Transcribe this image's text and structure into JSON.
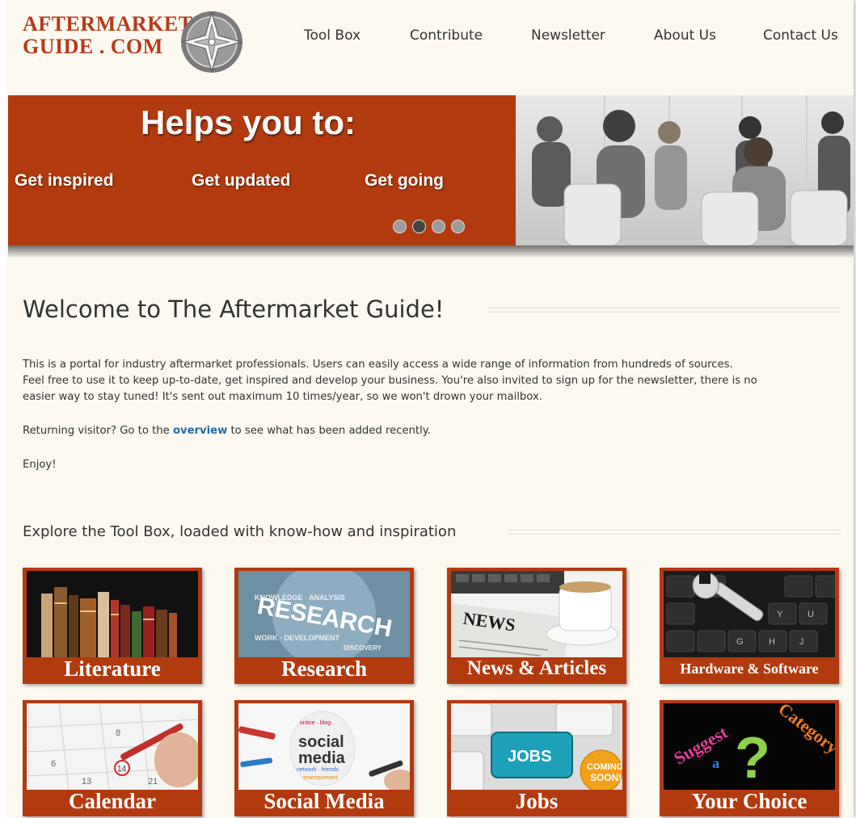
{
  "logo": {
    "line1": "AFTERMARKET",
    "line2": "GUIDE . COM"
  },
  "nav": {
    "items": [
      {
        "label": "Tool Box"
      },
      {
        "label": "Contribute"
      },
      {
        "label": "Newsletter"
      },
      {
        "label": "About Us"
      },
      {
        "label": "Contact Us"
      }
    ]
  },
  "banner": {
    "title": "Helps you to:",
    "items": [
      "Get inspired",
      "Get updated",
      "Get going"
    ],
    "slides": 4,
    "active_slide": 2
  },
  "welcome": {
    "heading": "Welcome to The Aftermarket Guide!",
    "para1_line1": "This is a portal for industry aftermarket professionals.  Users can easily access a wide  range of information from hundreds of sources.",
    "para1_line2": "Feel free to use it to keep up-to-date, get inspired and develop your business.  You're also invited to sign up for the newsletter, there is no",
    "para1_line3": "easier way to stay tuned! It's sent out maximum 10 times/year, so we won't drown your mailbox.",
    "returning_prefix": "Returning visitor? Go to the ",
    "returning_link": "overview",
    "returning_suffix": " to see what has been added recently.",
    "enjoy": "Enjoy!"
  },
  "toolbox": {
    "heading": "Explore the Tool Box, loaded with know-how and inspiration",
    "tiles": [
      {
        "label": "Literature"
      },
      {
        "label": "Research"
      },
      {
        "label": "News & Articles"
      },
      {
        "label": "Hardware & Software"
      },
      {
        "label": "Calendar"
      },
      {
        "label": "Social Media"
      },
      {
        "label": "Jobs"
      },
      {
        "label": "Your Choice"
      }
    ],
    "research_words": "RESEARCH",
    "news_word": "NEWS",
    "jobs_key": "JOBS",
    "jobs_badge_1": "COMING",
    "jobs_badge_2": "SOON!",
    "social_word_1": "social",
    "social_word_2": "media",
    "suggest_1": "Suggest",
    "suggest_2": "a",
    "suggest_3": "Category",
    "suggest_q": "?"
  },
  "colors": {
    "brand": "#b23a0f",
    "logo": "#b8391a",
    "page_bg": "#fdf9f1",
    "link": "#1e6aa8"
  }
}
